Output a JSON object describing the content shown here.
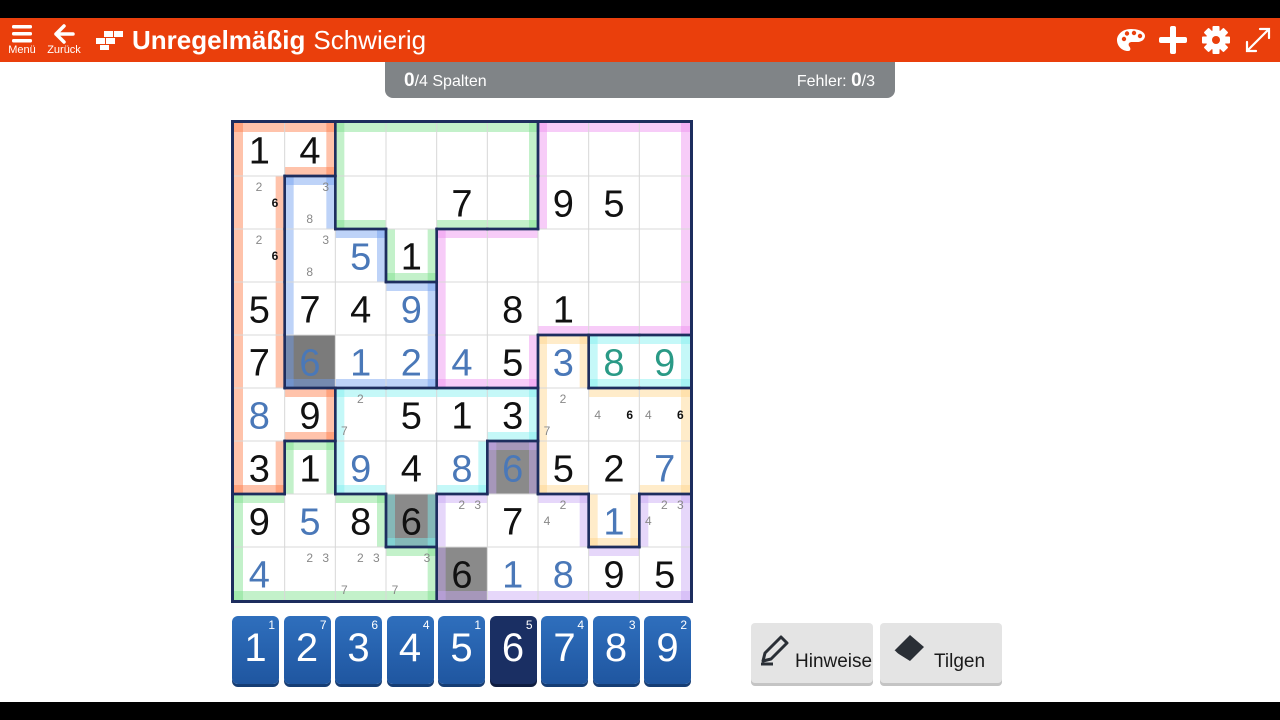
{
  "header": {
    "menu_label": "Menü",
    "back_label": "Zurück",
    "title_bold": "Unregelmäßig",
    "title_difficulty": "Schwierig",
    "bar_color": "#ea3f0c"
  },
  "status": {
    "columns_value": "0",
    "columns_suffix": "/4 Spalten",
    "errors_label": "Fehler: ",
    "errors_value": "0",
    "errors_suffix": "/3"
  },
  "board": {
    "regions": [
      "ooggggppp",
      "obggggppp",
      "obbgpppPp",
      "obbbppppP",
      "obbbpppyc",
      "occcccyy",
      "ogccvcvyvv",
      "gggcvvvvyv",
      "gggggvvvvv"
    ],
    "region_colors": {
      "o": "#ff7a45",
      "g": "#7be08a",
      "b": "#6f9ef0",
      "p": "#ee8ff0",
      "c": "#7ff0f0",
      "y": "#ffd48a",
      "v": "#c8a6f5"
    },
    "cells": [
      [
        {
          "v": "1",
          "k": "given"
        },
        {
          "v": "4",
          "k": "given"
        },
        {
          "v": ""
        },
        {
          "v": ""
        },
        {
          "v": ""
        },
        {
          "v": ""
        },
        {
          "v": ""
        },
        {
          "v": ""
        },
        {
          "v": ""
        }
      ],
      [
        {
          "n": [
            "2",
            "6b"
          ]
        },
        {
          "n": [
            "3",
            "8"
          ]
        },
        {
          "v": ""
        },
        {
          "v": ""
        },
        {
          "v": "7",
          "k": "given"
        },
        {
          "v": ""
        },
        {
          "v": "9",
          "k": "given"
        },
        {
          "v": "5",
          "k": "given"
        },
        {
          "v": ""
        }
      ],
      [
        {
          "n": [
            "2",
            "6b"
          ]
        },
        {
          "n": [
            "3",
            "8"
          ]
        },
        {
          "v": "5",
          "k": "user"
        },
        {
          "v": "1",
          "k": "given"
        },
        {
          "v": ""
        },
        {
          "v": ""
        },
        {
          "v": ""
        },
        {
          "v": ""
        },
        {
          "v": ""
        }
      ],
      [
        {
          "v": "5",
          "k": "given"
        },
        {
          "v": "7",
          "k": "given"
        },
        {
          "v": "4",
          "k": "given"
        },
        {
          "v": "9",
          "k": "user"
        },
        {
          "v": ""
        },
        {
          "v": "8",
          "k": "given"
        },
        {
          "v": "1",
          "k": "given"
        },
        {
          "v": ""
        },
        {
          "v": ""
        }
      ],
      [
        {
          "v": "7",
          "k": "given"
        },
        {
          "v": "6",
          "k": "user",
          "sel": true
        },
        {
          "v": "1",
          "k": "user"
        },
        {
          "v": "2",
          "k": "user"
        },
        {
          "v": "4",
          "k": "user"
        },
        {
          "v": "5",
          "k": "given"
        },
        {
          "v": "3",
          "k": "user"
        },
        {
          "v": "8",
          "k": "teal"
        },
        {
          "v": "9",
          "k": "teal"
        }
      ],
      [
        {
          "v": "8",
          "k": "user"
        },
        {
          "v": "9",
          "k": "given"
        },
        {
          "n": [
            "2",
            "7"
          ]
        },
        {
          "v": "5",
          "k": "given"
        },
        {
          "v": "1",
          "k": "given"
        },
        {
          "v": "3",
          "k": "given"
        },
        {
          "n": [
            "2",
            "7"
          ]
        },
        {
          "n": [
            "4",
            "6b"
          ]
        },
        {
          "n": [
            "4",
            "6b"
          ]
        }
      ],
      [
        {
          "v": "3",
          "k": "given"
        },
        {
          "v": "1",
          "k": "given"
        },
        {
          "v": "9",
          "k": "user"
        },
        {
          "v": "4",
          "k": "given"
        },
        {
          "v": "8",
          "k": "user"
        },
        {
          "v": "6",
          "k": "user",
          "hl": true
        },
        {
          "v": "5",
          "k": "given"
        },
        {
          "v": "2",
          "k": "given"
        },
        {
          "v": "7",
          "k": "user"
        }
      ],
      [
        {
          "v": "9",
          "k": "given"
        },
        {
          "v": "5",
          "k": "user"
        },
        {
          "v": "8",
          "k": "given"
        },
        {
          "v": "6",
          "k": "given",
          "hl": true
        },
        {
          "n": [
            "2",
            "3"
          ]
        },
        {
          "v": "7",
          "k": "given"
        },
        {
          "n": [
            "2",
            "4"
          ]
        },
        {
          "v": "1",
          "k": "user"
        },
        {
          "n": [
            "2",
            "3",
            "4"
          ]
        }
      ],
      [
        {
          "v": "4",
          "k": "user"
        },
        {
          "n": [
            "2",
            "3"
          ]
        },
        {
          "n": [
            "2",
            "3",
            "7"
          ]
        },
        {
          "n": [
            "3",
            "7"
          ]
        },
        {
          "v": "6",
          "k": "given",
          "hl": true
        },
        {
          "v": "1",
          "k": "user"
        },
        {
          "v": "8",
          "k": "user"
        },
        {
          "v": "9",
          "k": "given"
        },
        {
          "v": "5",
          "k": "given"
        }
      ]
    ]
  },
  "pad": [
    {
      "num": "1",
      "count": "1"
    },
    {
      "num": "2",
      "count": "7"
    },
    {
      "num": "3",
      "count": "6"
    },
    {
      "num": "4",
      "count": "4"
    },
    {
      "num": "5",
      "count": "1"
    },
    {
      "num": "6",
      "count": "5",
      "active": true
    },
    {
      "num": "7",
      "count": "4"
    },
    {
      "num": "8",
      "count": "3"
    },
    {
      "num": "9",
      "count": "2"
    }
  ],
  "tools": {
    "hints_label": "Hinweise",
    "erase_label": "Tilgen"
  },
  "colors": {
    "given": "#111111",
    "user": "#4a78b8",
    "teal": "#2a9a86",
    "note": "#888888",
    "pad_blue": "#2567b3",
    "pad_active": "#1a2f63"
  },
  "icons": [
    "menu-icon",
    "back-arrow-icon",
    "puzzle-logo-icon",
    "palette-icon",
    "plus-icon",
    "gear-icon",
    "fullscreen-icon",
    "pencil-icon",
    "eraser-icon"
  ]
}
